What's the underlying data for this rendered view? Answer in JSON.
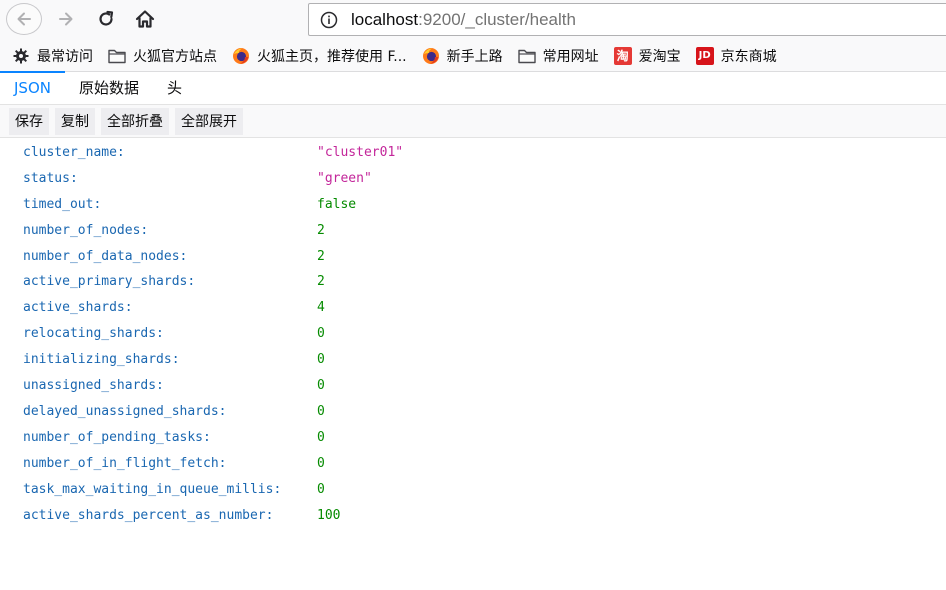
{
  "browser": {
    "url_host": "localhost",
    "url_path": ":9200/_cluster/health"
  },
  "bookmarks": [
    {
      "label": "最常访问",
      "icon": "gear-icon"
    },
    {
      "label": "火狐官方站点",
      "icon": "folder-icon"
    },
    {
      "label": "火狐主页，推荐使用 F...",
      "icon": "firefox-icon"
    },
    {
      "label": "新手上路",
      "icon": "firefox-icon"
    },
    {
      "label": "常用网址",
      "icon": "folder-icon"
    },
    {
      "label": "爱淘宝",
      "icon": "taobao-icon",
      "logo_text": "淘"
    },
    {
      "label": "京东商城",
      "icon": "jd-icon",
      "logo_text": "JD"
    }
  ],
  "tabs": [
    {
      "label": "JSON",
      "active": true
    },
    {
      "label": "原始数据",
      "active": false
    },
    {
      "label": "头",
      "active": false
    }
  ],
  "toolbar": {
    "save_label": "保存",
    "copy_label": "复制",
    "collapse_all_label": "全部折叠",
    "expand_all_label": "全部展开"
  },
  "colors": {
    "key": "#1a67b1",
    "string": "#c3269a",
    "number": "#058b00",
    "accent": "#0a84ff"
  },
  "json_rows": [
    {
      "key": "cluster_name:",
      "value": "\"cluster01\"",
      "type": "string"
    },
    {
      "key": "status:",
      "value": "\"green\"",
      "type": "string"
    },
    {
      "key": "timed_out:",
      "value": "false",
      "type": "bool"
    },
    {
      "key": "number_of_nodes:",
      "value": "2",
      "type": "number"
    },
    {
      "key": "number_of_data_nodes:",
      "value": "2",
      "type": "number"
    },
    {
      "key": "active_primary_shards:",
      "value": "2",
      "type": "number"
    },
    {
      "key": "active_shards:",
      "value": "4",
      "type": "number"
    },
    {
      "key": "relocating_shards:",
      "value": "0",
      "type": "number"
    },
    {
      "key": "initializing_shards:",
      "value": "0",
      "type": "number"
    },
    {
      "key": "unassigned_shards:",
      "value": "0",
      "type": "number"
    },
    {
      "key": "delayed_unassigned_shards:",
      "value": "0",
      "type": "number"
    },
    {
      "key": "number_of_pending_tasks:",
      "value": "0",
      "type": "number"
    },
    {
      "key": "number_of_in_flight_fetch:",
      "value": "0",
      "type": "number"
    },
    {
      "key": "task_max_waiting_in_queue_millis:",
      "value": "0",
      "type": "number"
    },
    {
      "key": "active_shards_percent_as_number:",
      "value": "100",
      "type": "number"
    }
  ]
}
